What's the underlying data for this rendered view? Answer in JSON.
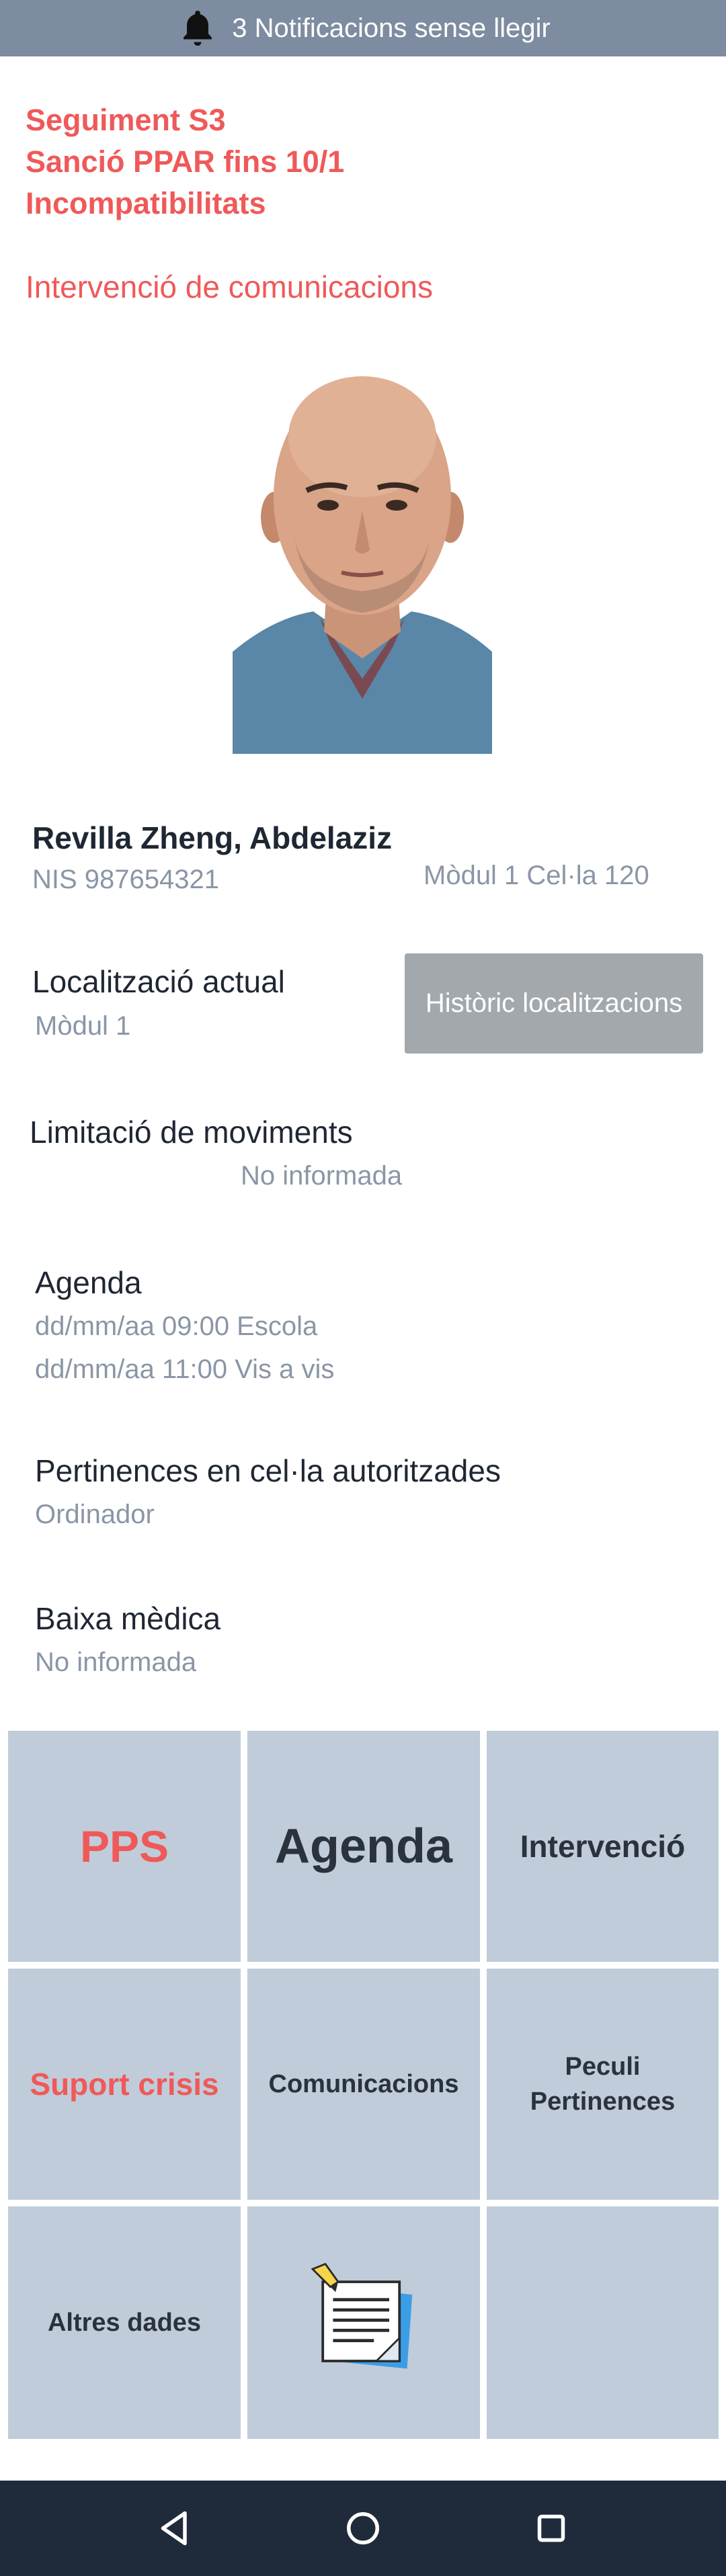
{
  "notifications": {
    "text": "3 Notificacions sense llegir",
    "icon": "bell-icon"
  },
  "alerts": [
    "Seguiment S3",
    "Sanció PPAR fins 10/1",
    "Incompatibilitats"
  ],
  "intervention_notice": "Intervenció de comunicacions",
  "inmate": {
    "name": "Revilla Zheng, Abdelaziz",
    "nis": "NIS 987654321",
    "cell": "Mòdul 1 Cel·la 120"
  },
  "location": {
    "label": "Localització actual",
    "value": "Mòdul 1",
    "history_button": "Històric localitzacions"
  },
  "movement_limit": {
    "label": "Limitació de moviments",
    "value": "No informada"
  },
  "agenda": {
    "label": "Agenda",
    "items": [
      "dd/mm/aa 09:00 Escola",
      "dd/mm/aa 11:00 Vis a vis"
    ]
  },
  "belongings": {
    "label": "Pertinences en cel·la autoritzades",
    "value": "Ordinador"
  },
  "sick_leave": {
    "label": "Baixa mèdica",
    "value": "No informada"
  },
  "tiles": {
    "pps": "PPS",
    "agenda": "Agenda",
    "intervencio": "Intervenció",
    "suport": "Suport crisis",
    "comunicacions": "Comunicacions",
    "peculi_1": "Peculi",
    "peculi_2": "Pertinences",
    "altres": "Altres dades",
    "notes_icon": "notepad-icon"
  },
  "colors": {
    "accent": "#ef5959",
    "tile": "#c0ccd9",
    "notif_bar": "#7d8ca0",
    "nav_bar": "#1f2a3a"
  },
  "navbar": {
    "icons": [
      "back-triangle-icon",
      "home-circle-icon",
      "recents-square-icon"
    ]
  }
}
